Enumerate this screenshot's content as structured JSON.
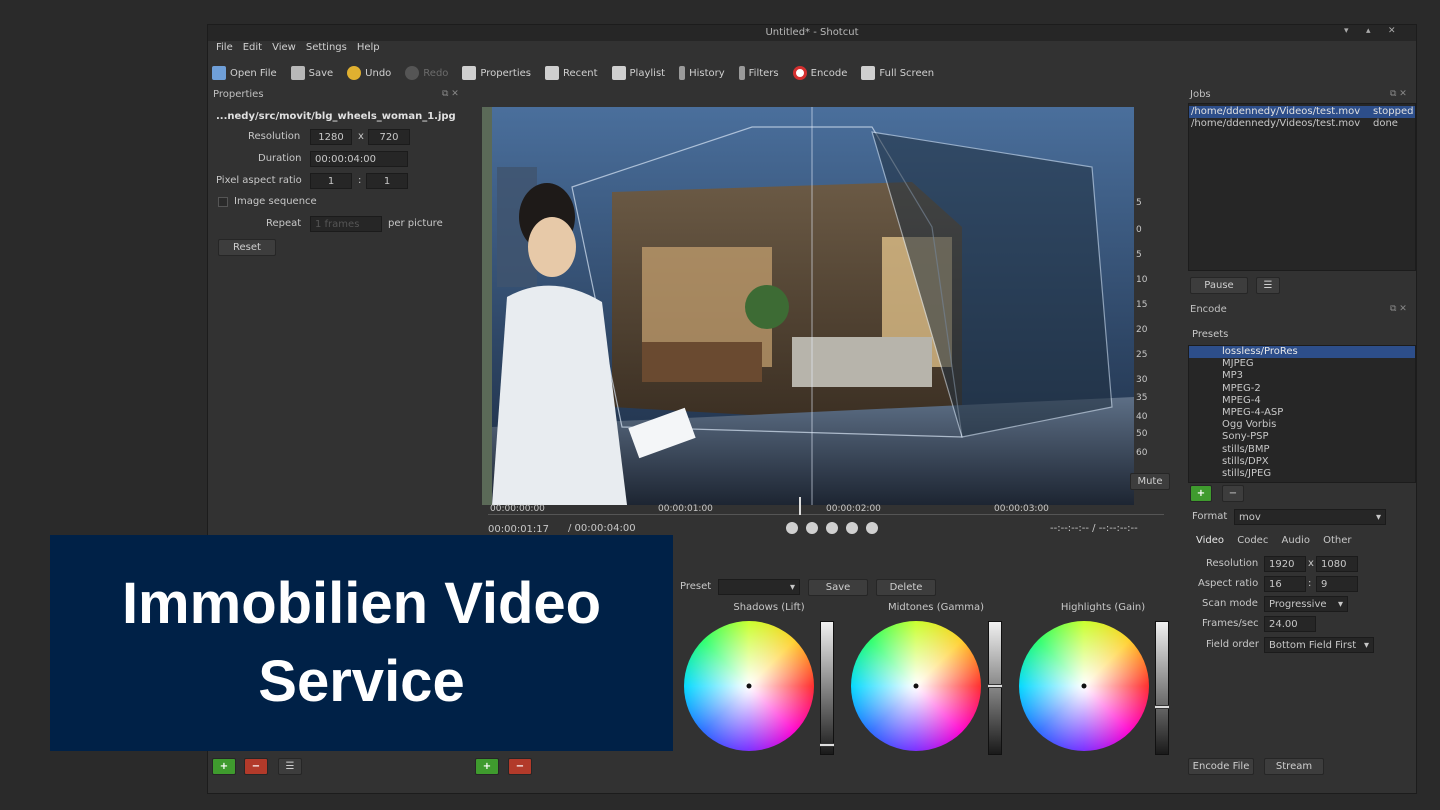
{
  "window": {
    "title": "Untitled* - Shotcut",
    "controls": [
      "▾",
      "▴",
      "✕"
    ]
  },
  "menu": [
    "File",
    "Edit",
    "View",
    "Settings",
    "Help"
  ],
  "toolbar": {
    "open_file": "Open File",
    "save": "Save",
    "undo": "Undo",
    "redo": "Redo",
    "properties": "Properties",
    "recent": "Recent",
    "playlist": "Playlist",
    "history": "History",
    "filters": "Filters",
    "encode": "Encode",
    "full_screen": "Full Screen"
  },
  "properties": {
    "title": "Properties",
    "file": "...nedy/src/movit/blg_wheels_woman_1.jpg",
    "resolution_label": "Resolution",
    "res_w": "1280",
    "res_x": "x",
    "res_h": "720",
    "duration_label": "Duration",
    "duration": "00:00:04:00",
    "par_label": "Pixel aspect ratio",
    "par_a": "1",
    "par_sep": ":",
    "par_b": "1",
    "image_sequence": "Image sequence",
    "repeat_label": "Repeat",
    "repeat_value": "1 frames",
    "per_picture": "per picture",
    "reset": "Reset"
  },
  "player": {
    "ticks": [
      "00:00:00:00",
      "00:00:01:00",
      "00:00:02:00",
      "00:00:03:00"
    ],
    "position": "00:00:01:17",
    "total": "/ 00:00:04:00",
    "inout": "--:--:--:-- / --:--:--:--",
    "playhead_fraction": 0.46,
    "side_numbers": [
      "5",
      "0",
      "5",
      "10",
      "15",
      "20",
      "25",
      "30",
      "35",
      "40",
      "50",
      "60"
    ],
    "mute": "Mute"
  },
  "jobs": {
    "title": "Jobs",
    "items": [
      {
        "path": "/home/ddennedy/Videos/test.mov",
        "status": "stopped"
      },
      {
        "path": "/home/ddennedy/Videos/test.mov",
        "status": "done"
      }
    ],
    "pause": "Pause",
    "menu": "☰"
  },
  "encode": {
    "title": "Encode",
    "presets_label": "Presets",
    "presets": [
      "lossless/ProRes",
      "MJPEG",
      "MP3",
      "MPEG-2",
      "MPEG-4",
      "MPEG-4-ASP",
      "Ogg Vorbis",
      "Sony-PSP",
      "stills/BMP",
      "stills/DPX",
      "stills/JPEG"
    ],
    "format_label": "Format",
    "format": "mov",
    "tabs": [
      "Video",
      "Codec",
      "Audio",
      "Other"
    ],
    "resolution_label": "Resolution",
    "res_w": "1920",
    "res_x": "x",
    "res_h": "1080",
    "aspect_label": "Aspect ratio",
    "aspect_a": "16",
    "aspect_sep": ":",
    "aspect_b": "9",
    "scan_label": "Scan mode",
    "scan": "Progressive",
    "fps_label": "Frames/sec",
    "fps": "24.00",
    "field_label": "Field order",
    "field": "Bottom Field First",
    "encode_file": "Encode File",
    "stream": "Stream"
  },
  "color_grading": {
    "preset_label": "Preset",
    "save": "Save",
    "delete": "Delete",
    "wheels": [
      {
        "label": "Shadows (Lift)",
        "level": 0.04
      },
      {
        "label": "Midtones (Gamma)",
        "level": 0.51
      },
      {
        "label": "Highlights (Gain)",
        "level": 0.34
      }
    ]
  },
  "bottom_buttons": {
    "add": "+",
    "remove": "−",
    "menu": "☰"
  },
  "banner": {
    "line1": "Immobilien Video",
    "line2": "Service",
    "background": "#002147"
  },
  "colors": {
    "selection": "#2d4e8a",
    "add_green": "#3f9b2e",
    "remove_red": "#b23a2a",
    "record_red": "#d43030"
  }
}
